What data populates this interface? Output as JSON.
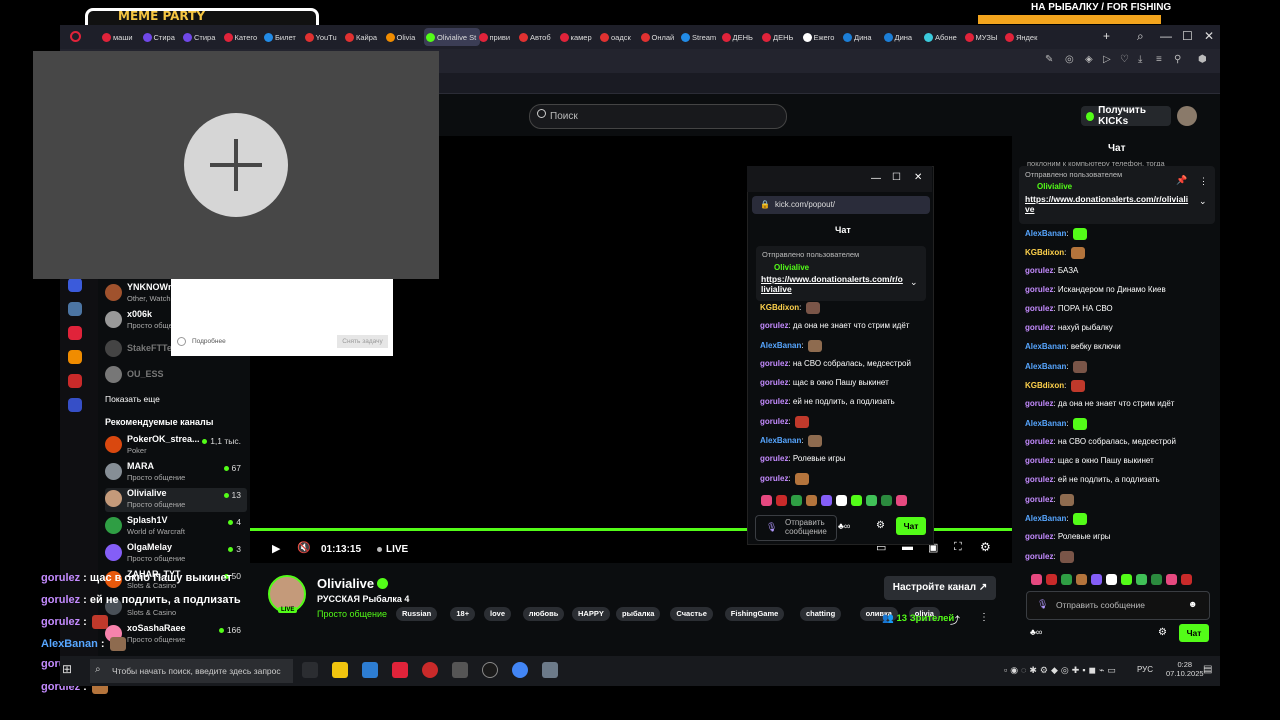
{
  "stream_overlay": {
    "meme_banner": "MEME PARTY",
    "fishing_title": "НА РЫБАЛКУ / FOR FISHING",
    "chat_lines": [
      {
        "user": "gorulez",
        "text": "щас в окно Пашу выкинет",
        "color": "#c48bff"
      },
      {
        "user": "gorulez",
        "text": "ей не подлить, а подлизать",
        "color": "#c48bff"
      },
      {
        "user": "gorulez",
        "text": "",
        "color": "#c48bff"
      },
      {
        "user": "AlexBanan",
        "text": "",
        "color": "#57a6ff"
      },
      {
        "user": "gorulez",
        "text": "Ролевые игры",
        "color": "#c48bff"
      },
      {
        "user": "gorulez",
        "text": "",
        "color": "#c48bff"
      }
    ]
  },
  "browser": {
    "tabs": [
      "маши",
      "Стира",
      "Стира",
      "Катего",
      "Билет",
      "YouTu",
      "Кайра",
      "Olivia",
      "Olivialive St",
      "приви",
      "Автоб",
      "камер",
      "оадск",
      "Онлай",
      "Stream",
      "ДЕНЬ",
      "ДЕНЬ",
      "Ежего",
      "Дина",
      "Дина",
      "Абоне",
      "МУЗЫ",
      "Яндек"
    ],
    "active_tab_index": 8,
    "accent": "#53fc18"
  },
  "kick": {
    "search_placeholder": "Поиск",
    "get_kicks_label": "Получить KICKs",
    "sidebar": {
      "followed": [
        {
          "name": "YNKNOWn",
          "category": "Other, Watch",
          "count": ""
        },
        {
          "name": "x006k",
          "category": "Просто общение",
          "count": ""
        },
        {
          "name": "StakeFTTe",
          "category": "",
          "count": ""
        },
        {
          "name": "OU_ESS",
          "category": "",
          "count": ""
        }
      ],
      "show_more": "Показать еще",
      "recommended_title": "Рекомендуемые каналы",
      "recommended": [
        {
          "name": "PokerOK_strea...",
          "category": "Poker",
          "count": "1,1 тыс."
        },
        {
          "name": "MARA",
          "category": "Просто общение",
          "count": "67"
        },
        {
          "name": "Olivialive",
          "category": "Просто общение",
          "count": "13"
        },
        {
          "name": "Splash1V",
          "category": "World of Warcraft",
          "count": "4"
        },
        {
          "name": "OlgaMelay",
          "category": "Просто общение",
          "count": "3"
        },
        {
          "name": "ZAHAR_TYT",
          "category": "Slots & Casino",
          "count": "50"
        },
        {
          "name": "",
          "category": "Slots & Casino",
          "count": ""
        },
        {
          "name": "xoSashaRaee",
          "category": "Просто общение",
          "count": "166"
        }
      ]
    },
    "player": {
      "time": "01:13:15",
      "live": "LIVE"
    },
    "stream_info": {
      "streamer": "Olivialive",
      "title": "РУССКАЯ Рыбалка 4",
      "category": "Просто общение",
      "live_badge": "LIVE",
      "tags": [
        "Russian",
        "18+",
        "love",
        "любовь",
        "HAPPY",
        "рыбалка",
        "Счастье",
        "FishingGame",
        "chatting",
        "оливка",
        "olivia"
      ],
      "setup_button": "Настройте канал",
      "viewers": "13",
      "viewers_label": "Зрителей"
    },
    "chat": {
      "title": "Чат",
      "top_fragment": "поклоним к компьютеру телефон, тогда",
      "pinned_label": "Отправлено пользователем",
      "pinned_user": "Olivialive",
      "pinned_link": "https://www.donationalerts.com/r/olivialive",
      "messages": [
        {
          "user": "AlexBanan",
          "text": "",
          "color": "blue"
        },
        {
          "user": "KGBdixon",
          "text": "",
          "color": "yellow"
        },
        {
          "user": "gorulez",
          "text": "БАЗА",
          "color": "purple"
        },
        {
          "user": "gorulez",
          "text": "Искандером по Динамо Киев",
          "color": "purple"
        },
        {
          "user": "gorulez",
          "text": "ПОРА НА СВО",
          "color": "purple"
        },
        {
          "user": "gorulez",
          "text": "нахуй рыбалку",
          "color": "purple"
        },
        {
          "user": "AlexBanan",
          "text": "вебку включи",
          "color": "blue"
        },
        {
          "user": "AlexBanan",
          "text": "",
          "color": "blue"
        },
        {
          "user": "KGBdixon",
          "text": "",
          "color": "yellow"
        },
        {
          "user": "gorulez",
          "text": "да она не знает что стрим идёт",
          "color": "purple"
        },
        {
          "user": "AlexBanan",
          "text": "",
          "color": "blue"
        },
        {
          "user": "gorulez",
          "text": "на СВО собралась, медсестрой",
          "color": "purple"
        },
        {
          "user": "gorulez",
          "text": "щас в окно Пашу выкинет",
          "color": "purple"
        },
        {
          "user": "gorulez",
          "text": "ей не подлить, а подлизать",
          "color": "purple"
        },
        {
          "user": "gorulez",
          "text": "",
          "color": "purple"
        },
        {
          "user": "AlexBanan",
          "text": "",
          "color": "blue"
        },
        {
          "user": "gorulez",
          "text": "Ролевые игры",
          "color": "purple"
        },
        {
          "user": "gorulez",
          "text": "",
          "color": "purple"
        }
      ],
      "input_placeholder": "Отправить сообщение",
      "send_label": "Чат"
    },
    "popout": {
      "url": "kick.com/popout/",
      "title": "Чат",
      "pinned_label": "Отправлено пользователем",
      "pinned_user": "Olivialive",
      "pinned_link": "https://www.donationalerts.com/r/olivialive",
      "messages": [
        {
          "user": "KGBdixon",
          "text": "",
          "color": "yellow"
        },
        {
          "user": "gorulez",
          "text": "да она не знает что стрим идёт",
          "color": "purple"
        },
        {
          "user": "AlexBanan",
          "text": "",
          "color": "blue"
        },
        {
          "user": "gorulez",
          "text": "на СВО собралась, медсестрой",
          "color": "purple"
        },
        {
          "user": "gorulez",
          "text": "щас в окно Пашу выкинет",
          "color": "purple"
        },
        {
          "user": "gorulez",
          "text": "ей не подлить, а подлизать",
          "color": "purple"
        },
        {
          "user": "gorulez",
          "text": "",
          "color": "purple"
        },
        {
          "user": "AlexBanan",
          "text": "",
          "color": "blue"
        },
        {
          "user": "gorulez",
          "text": "Ролевые игры",
          "color": "purple"
        },
        {
          "user": "gorulez",
          "text": "",
          "color": "purple"
        }
      ],
      "input_placeholder": "Отправить сообщение",
      "send_label": "Чат"
    }
  },
  "dialog": {
    "details_label": "Подробнее",
    "button_label": "Снять задачу"
  },
  "taskbar": {
    "search_placeholder": "Чтобы начать поиск, введите здесь запрос",
    "lang": "РУС",
    "time": "0:28",
    "date": "07.10.2025"
  }
}
